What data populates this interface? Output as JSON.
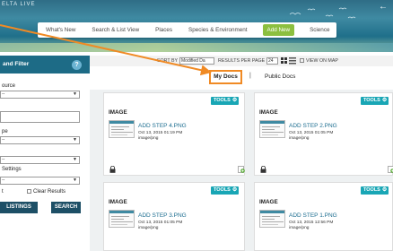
{
  "app": {
    "brand": "ELTA LIVE"
  },
  "nav": {
    "items": [
      "What's New",
      "Search & List View",
      "Places",
      "Species & Environment",
      "Add New",
      "Science"
    ],
    "active_index": 4
  },
  "sidebar": {
    "title": "and Filter",
    "help": "?",
    "source_label": "ource",
    "source_value": "--",
    "type_label": "pe",
    "type_value": "--",
    "third_value": "--",
    "settings_label": "Settings",
    "settings_value": "--",
    "check_t_label": "t",
    "clear_results_label": "Clear Results",
    "listings_button": "LISTINGS",
    "search_button": "SEARCH"
  },
  "toolbar": {
    "sort_by_label": "SORT BY",
    "sort_by_value": "Modified Da",
    "results_per_page_label": "RESULTS PER PAGE",
    "results_per_page_value": "24",
    "view_on_map_label": "VIEW ON MAP"
  },
  "tabs": {
    "my_docs": "My Docs",
    "separator": "|",
    "public_docs": "Public Docs"
  },
  "cards": [
    {
      "type": "IMAGE",
      "tools": "TOOLS",
      "title": "ADD STEP 4.PNG",
      "date": "Oct 13, 2015 01:19 PM",
      "mime": "image/png"
    },
    {
      "type": "IMAGE",
      "tools": "TOOLS",
      "title": "ADD STEP 2.PNG",
      "date": "Oct 13, 2015 01:05 PM",
      "mime": "image/png"
    },
    {
      "type": "IMAGE",
      "tools": "TOOLS",
      "title": "ADD STEP 3.PNG",
      "date": "Oct 13, 2015 01:05 PM",
      "mime": "image/png"
    },
    {
      "type": "IMAGE",
      "tools": "TOOLS",
      "title": "ADD STEP 1.PNG",
      "date": "Oct 13, 2015 12:56 PM",
      "mime": "image/png"
    }
  ],
  "colors": {
    "header_blue": "#1d6b86",
    "nav_active_green": "#8cbf3f",
    "tools_teal": "#19a6b5",
    "highlight_orange": "#f08a24",
    "link_blue": "#1b6c8f"
  },
  "icons": [
    "back-arrow-icon",
    "help-icon",
    "grid-view-icon",
    "list-view-icon",
    "map-checkbox-icon",
    "gear-icon",
    "lock-icon",
    "add-document-icon",
    "chevron-down-icon"
  ]
}
